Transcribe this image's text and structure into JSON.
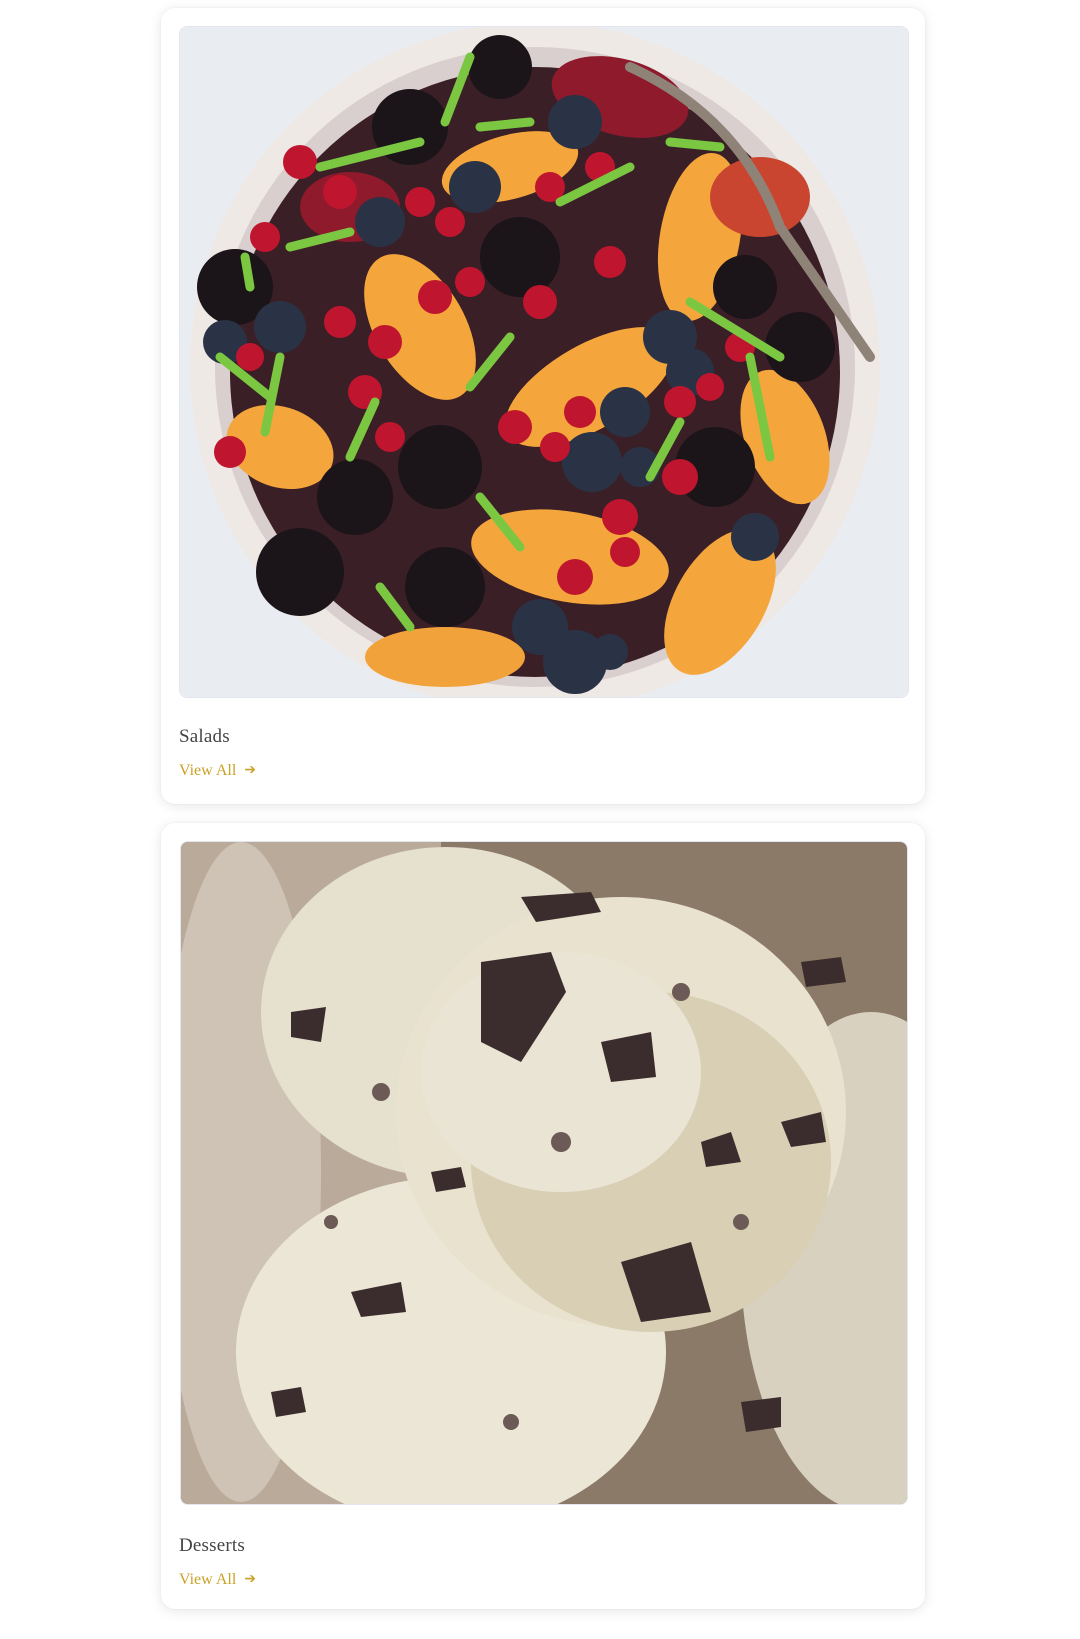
{
  "categories": [
    {
      "title": "Salads",
      "link_label": "View All",
      "link_icon": "arrow-right-icon",
      "image_subject": "fruit-salad-bowl-photo"
    },
    {
      "title": "Desserts",
      "link_label": "View All",
      "link_icon": "arrow-right-icon",
      "image_subject": "ice-cream-scoops-photo"
    }
  ],
  "colors": {
    "link": "#c9a227",
    "title": "#444444",
    "card_bg": "#ffffff"
  }
}
